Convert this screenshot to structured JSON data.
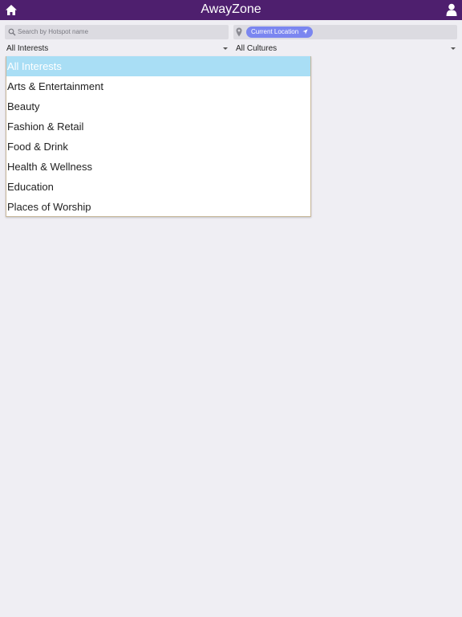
{
  "header": {
    "title": "AwayZone",
    "home_icon": "home-icon",
    "user_icon": "user-icon",
    "background_color": "#4e1f6e"
  },
  "search": {
    "placeholder": "Search by Hotspot name",
    "icon": "search-icon"
  },
  "location": {
    "icon": "map-pin-icon",
    "button_label": "Current Location",
    "button_icon": "location-arrow-icon",
    "button_color": "#7b86f0"
  },
  "filters": {
    "interests_selected": "All Interests",
    "cultures_selected": "All Cultures"
  },
  "interests_dropdown": {
    "options": [
      "All Interests",
      "Arts & Entertainment",
      "Beauty",
      "Fashion & Retail",
      "Food & Drink",
      "Health & Wellness",
      "Education",
      "Places of Worship"
    ],
    "selected_index": 0,
    "highlight_color": "#a9def5"
  }
}
